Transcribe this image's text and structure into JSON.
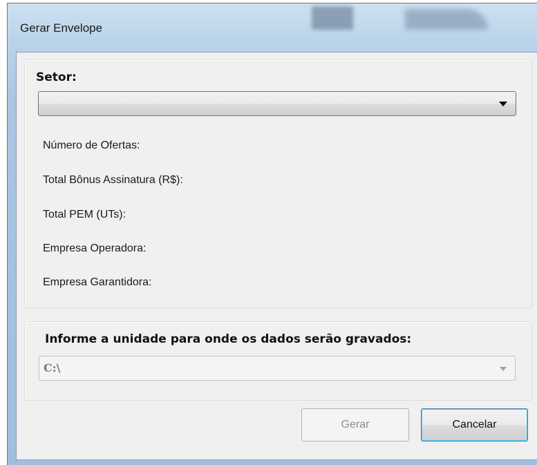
{
  "window": {
    "title": "Gerar Envelope"
  },
  "setor": {
    "label": "Setor:",
    "selected": ""
  },
  "info": {
    "numero_ofertas": "Número de Ofertas:",
    "total_bonus": "Total Bônus Assinatura (R$):",
    "total_pem": "Total PEM (UTs):",
    "empresa_operadora": "Empresa Operadora:",
    "empresa_garantidora": "Empresa Garantidora:"
  },
  "unidade": {
    "label": "Informe a unidade para onde os dados serão gravados:",
    "selected": "C:\\"
  },
  "buttons": {
    "gerar": "Gerar",
    "cancelar": "Cancelar"
  },
  "icons": {
    "setor_dropdown": "chevron-down-icon",
    "unidade_dropdown": "chevron-down-icon"
  },
  "colors": {
    "client_bg": "#f0f0f0",
    "focus_border": "#3c7fb1",
    "disabled_text": "#8c8c8c"
  }
}
